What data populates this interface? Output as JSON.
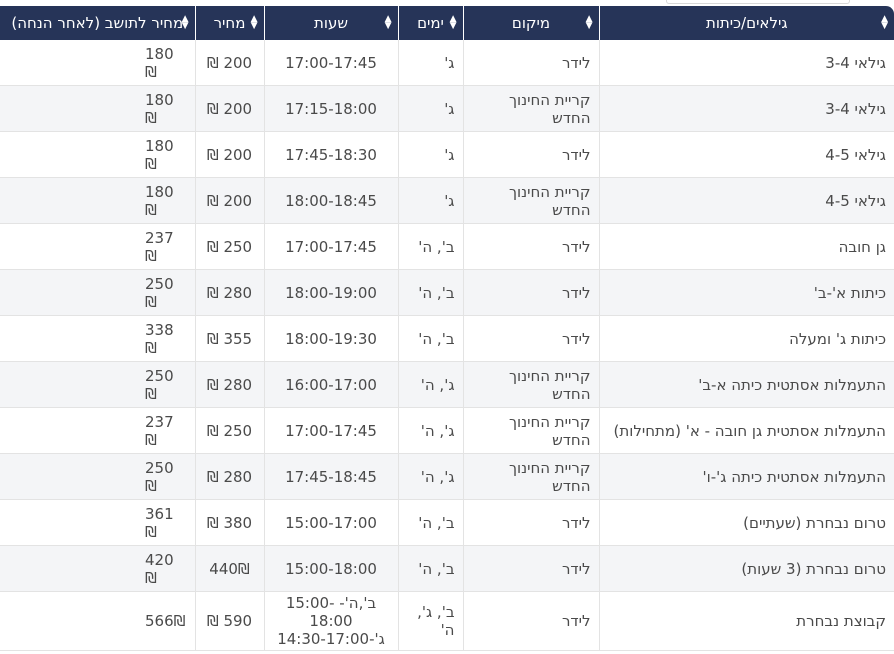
{
  "table": {
    "headers": [
      {
        "key": "name",
        "label": "גילאים/כיתות"
      },
      {
        "key": "location",
        "label": "מיקום"
      },
      {
        "key": "days",
        "label": "ימים"
      },
      {
        "key": "hours",
        "label": "שעות"
      },
      {
        "key": "price",
        "label": "מחיר"
      },
      {
        "key": "discount",
        "label": "מחיר לתושב (לאחר הנחה)"
      }
    ],
    "rows": [
      {
        "name": "גילאי 3-4",
        "location": "לידר",
        "days": "ג'",
        "hours": "17:00-17:45",
        "price": "200 ₪",
        "discount": "180 ₪"
      },
      {
        "name": "גילאי 3-4",
        "location": "קריית החינוך החדש",
        "days": "ג'",
        "hours": "17:15-18:00",
        "price": "200 ₪",
        "discount": "180 ₪"
      },
      {
        "name": "גילאי 4-5",
        "location": "לידר",
        "days": "ג'",
        "hours": "17:45-18:30",
        "price": "200 ₪",
        "discount": "180 ₪"
      },
      {
        "name": "גילאי 4-5",
        "location": "קריית החינוך החדש",
        "days": "ג'",
        "hours": "18:00-18:45",
        "price": "200 ₪",
        "discount": "180 ₪"
      },
      {
        "name": "גן חובה",
        "location": "לידר",
        "days": "ב', ה'",
        "hours": "17:00-17:45",
        "price": "250 ₪",
        "discount": "237 ₪"
      },
      {
        "name": "כיתות א'-ב'",
        "location": "לידר",
        "days": "ב', ה'",
        "hours": "18:00-19:00",
        "price": "280 ₪",
        "discount": "250 ₪"
      },
      {
        "name": "כיתות ג' ומעלה",
        "location": "לידר",
        "days": "ב', ה'",
        "hours": "18:00-19:30",
        "price": "355 ₪",
        "discount": "338 ₪"
      },
      {
        "name": "התעמלות אסתטית כיתה א-ב'",
        "location": "קריית החינוך החדש",
        "days": "ג', ה'",
        "hours": "16:00-17:00",
        "price": "280 ₪",
        "discount": "250 ₪"
      },
      {
        "name": "התעמלות אסתטית גן חובה - א' (מתחילות)",
        "location": "קריית החינוך החדש",
        "days": "ג', ה'",
        "hours": "17:00-17:45",
        "price": "250 ₪",
        "discount": "237 ₪"
      },
      {
        "name": "התעמלות אסתטית כיתה ג'-ו'",
        "location": "קריית החינוך החדש",
        "days": "ג', ה'",
        "hours": "17:45-18:45",
        "price": "280 ₪",
        "discount": "250 ₪"
      },
      {
        "name": "טרום נבחרת (שעתיים)",
        "location": "לידר",
        "days": "ב', ה'",
        "hours": "15:00-17:00",
        "price": "380 ₪",
        "discount": "361 ₪"
      },
      {
        "name": "טרום נבחרת (3 שעות)",
        "location": "לידר",
        "days": "ב', ה'",
        "hours": "15:00-18:00",
        "price": "440₪",
        "discount": "420 ₪"
      },
      {
        "name": "קבוצת נבחרת",
        "location": "לידר",
        "days_lines": [
          "ב', ג',",
          "ה'"
        ],
        "hours_lines": [
          "ב',ה'- 15:00-18:00",
          "ג'-14:30-17:00"
        ],
        "price": "590 ₪",
        "discount": "566₪"
      }
    ]
  },
  "icons": {
    "sort": "sort-arrows-icon"
  },
  "colors": {
    "header_bg": "#263458",
    "header_text": "#ffffff",
    "row_alt": "#f4f5f7"
  }
}
